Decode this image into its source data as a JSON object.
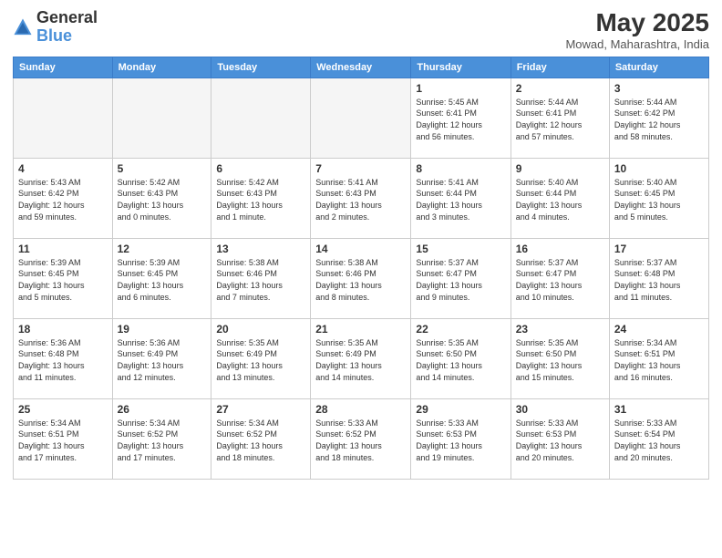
{
  "header": {
    "logo_general": "General",
    "logo_blue": "Blue",
    "month_year": "May 2025",
    "location": "Mowad, Maharashtra, India"
  },
  "days_of_week": [
    "Sunday",
    "Monday",
    "Tuesday",
    "Wednesday",
    "Thursday",
    "Friday",
    "Saturday"
  ],
  "weeks": [
    [
      {
        "day": "",
        "info": ""
      },
      {
        "day": "",
        "info": ""
      },
      {
        "day": "",
        "info": ""
      },
      {
        "day": "",
        "info": ""
      },
      {
        "day": "1",
        "info": "Sunrise: 5:45 AM\nSunset: 6:41 PM\nDaylight: 12 hours\nand 56 minutes."
      },
      {
        "day": "2",
        "info": "Sunrise: 5:44 AM\nSunset: 6:41 PM\nDaylight: 12 hours\nand 57 minutes."
      },
      {
        "day": "3",
        "info": "Sunrise: 5:44 AM\nSunset: 6:42 PM\nDaylight: 12 hours\nand 58 minutes."
      }
    ],
    [
      {
        "day": "4",
        "info": "Sunrise: 5:43 AM\nSunset: 6:42 PM\nDaylight: 12 hours\nand 59 minutes."
      },
      {
        "day": "5",
        "info": "Sunrise: 5:42 AM\nSunset: 6:43 PM\nDaylight: 13 hours\nand 0 minutes."
      },
      {
        "day": "6",
        "info": "Sunrise: 5:42 AM\nSunset: 6:43 PM\nDaylight: 13 hours\nand 1 minute."
      },
      {
        "day": "7",
        "info": "Sunrise: 5:41 AM\nSunset: 6:43 PM\nDaylight: 13 hours\nand 2 minutes."
      },
      {
        "day": "8",
        "info": "Sunrise: 5:41 AM\nSunset: 6:44 PM\nDaylight: 13 hours\nand 3 minutes."
      },
      {
        "day": "9",
        "info": "Sunrise: 5:40 AM\nSunset: 6:44 PM\nDaylight: 13 hours\nand 4 minutes."
      },
      {
        "day": "10",
        "info": "Sunrise: 5:40 AM\nSunset: 6:45 PM\nDaylight: 13 hours\nand 5 minutes."
      }
    ],
    [
      {
        "day": "11",
        "info": "Sunrise: 5:39 AM\nSunset: 6:45 PM\nDaylight: 13 hours\nand 5 minutes."
      },
      {
        "day": "12",
        "info": "Sunrise: 5:39 AM\nSunset: 6:45 PM\nDaylight: 13 hours\nand 6 minutes."
      },
      {
        "day": "13",
        "info": "Sunrise: 5:38 AM\nSunset: 6:46 PM\nDaylight: 13 hours\nand 7 minutes."
      },
      {
        "day": "14",
        "info": "Sunrise: 5:38 AM\nSunset: 6:46 PM\nDaylight: 13 hours\nand 8 minutes."
      },
      {
        "day": "15",
        "info": "Sunrise: 5:37 AM\nSunset: 6:47 PM\nDaylight: 13 hours\nand 9 minutes."
      },
      {
        "day": "16",
        "info": "Sunrise: 5:37 AM\nSunset: 6:47 PM\nDaylight: 13 hours\nand 10 minutes."
      },
      {
        "day": "17",
        "info": "Sunrise: 5:37 AM\nSunset: 6:48 PM\nDaylight: 13 hours\nand 11 minutes."
      }
    ],
    [
      {
        "day": "18",
        "info": "Sunrise: 5:36 AM\nSunset: 6:48 PM\nDaylight: 13 hours\nand 11 minutes."
      },
      {
        "day": "19",
        "info": "Sunrise: 5:36 AM\nSunset: 6:49 PM\nDaylight: 13 hours\nand 12 minutes."
      },
      {
        "day": "20",
        "info": "Sunrise: 5:35 AM\nSunset: 6:49 PM\nDaylight: 13 hours\nand 13 minutes."
      },
      {
        "day": "21",
        "info": "Sunrise: 5:35 AM\nSunset: 6:49 PM\nDaylight: 13 hours\nand 14 minutes."
      },
      {
        "day": "22",
        "info": "Sunrise: 5:35 AM\nSunset: 6:50 PM\nDaylight: 13 hours\nand 14 minutes."
      },
      {
        "day": "23",
        "info": "Sunrise: 5:35 AM\nSunset: 6:50 PM\nDaylight: 13 hours\nand 15 minutes."
      },
      {
        "day": "24",
        "info": "Sunrise: 5:34 AM\nSunset: 6:51 PM\nDaylight: 13 hours\nand 16 minutes."
      }
    ],
    [
      {
        "day": "25",
        "info": "Sunrise: 5:34 AM\nSunset: 6:51 PM\nDaylight: 13 hours\nand 17 minutes."
      },
      {
        "day": "26",
        "info": "Sunrise: 5:34 AM\nSunset: 6:52 PM\nDaylight: 13 hours\nand 17 minutes."
      },
      {
        "day": "27",
        "info": "Sunrise: 5:34 AM\nSunset: 6:52 PM\nDaylight: 13 hours\nand 18 minutes."
      },
      {
        "day": "28",
        "info": "Sunrise: 5:33 AM\nSunset: 6:52 PM\nDaylight: 13 hours\nand 18 minutes."
      },
      {
        "day": "29",
        "info": "Sunrise: 5:33 AM\nSunset: 6:53 PM\nDaylight: 13 hours\nand 19 minutes."
      },
      {
        "day": "30",
        "info": "Sunrise: 5:33 AM\nSunset: 6:53 PM\nDaylight: 13 hours\nand 20 minutes."
      },
      {
        "day": "31",
        "info": "Sunrise: 5:33 AM\nSunset: 6:54 PM\nDaylight: 13 hours\nand 20 minutes."
      }
    ]
  ]
}
